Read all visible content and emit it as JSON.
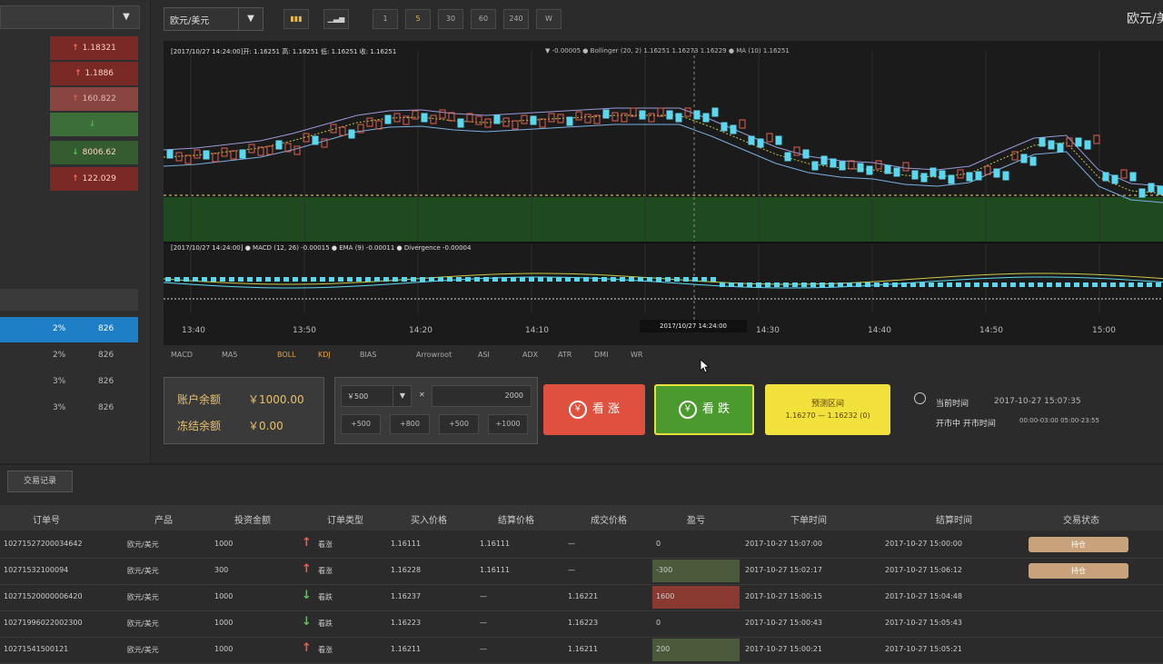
{
  "left_panel": {
    "select_value": "",
    "price_chips": [
      {
        "dir": "up",
        "value": "1.18321",
        "color": "#7a2a26"
      },
      {
        "dir": "up",
        "value": "1.1886",
        "color": "#7a2a26"
      },
      {
        "dir": "up",
        "value": "160.822",
        "color": "#9a4a44",
        "light": true
      },
      {
        "dir": "down",
        "value": "",
        "color": "#3e7a3a",
        "light": true
      },
      {
        "dir": "down",
        "value": "8006.62",
        "color": "#355c31"
      },
      {
        "dir": "up",
        "value": "122.029",
        "color": "#7a2a26"
      }
    ],
    "sub_headers": [
      "",
      "",
      ""
    ],
    "sub_rows": [
      {
        "c1": "2%",
        "c2": "826",
        "selected": true
      },
      {
        "c1": "2%",
        "c2": "826",
        "selected": false
      },
      {
        "c1": "3%",
        "c2": "826",
        "selected": false
      },
      {
        "c1": "3%",
        "c2": "826",
        "selected": false
      }
    ]
  },
  "toolbar": {
    "symbol_select": "欧元/美元",
    "chart_type_icons": [
      "candles-icon",
      "bars-icon"
    ],
    "timeframes": [
      "1",
      "5",
      "30",
      "60",
      "240",
      "W"
    ],
    "active_timeframe": "5",
    "pair_title": "欧元/美元"
  },
  "chart": {
    "main_caption": "[2017/10/27 14:24:00]开: 1.16251  高: 1.16251  低: 1.16251  收: 1.16251",
    "main_indicators": "▼ -0.00005   ● Bollinger (20, 2)   1.16251   1.16273   1.16229   ● MA (10)   1.16251",
    "sub_caption": "[2017/10/27 14:24:00]  ● MACD (12, 26)  -0.00015   ● EMA (9)  -0.00011   ● Divergence  -0.00004",
    "time_labels": [
      "13:40",
      "13:50",
      "14:20",
      "14:10",
      "14:30",
      "14:40",
      "14:50",
      "15:00"
    ],
    "cursor_time": "2017/10/27 14:24:00",
    "indicator_tabs": [
      "MACD",
      "MA5",
      "BOLL",
      "KDJ",
      "BIAS",
      "Arrowroot",
      "ASI",
      "ADX",
      "ATR",
      "DMI",
      "WR"
    ],
    "active_indicator_tabs": [
      "BOLL",
      "KDJ"
    ]
  },
  "account": {
    "balance_label": "账户余额",
    "balance_value": "￥1000.00",
    "frozen_label": "冻结余额",
    "frozen_value": "￥0.00"
  },
  "order_entry": {
    "amount_select": "￥500",
    "amount_input": "2000",
    "quick_amounts": [
      "+500",
      "+800",
      "+500",
      "+1000"
    ]
  },
  "actions": {
    "buy_up_label": "看 涨",
    "buy_down_label": "看 跌",
    "yellow_top": "预测区间",
    "yellow_bottom": "1.16270 — 1.16232 (0)",
    "buy_up_color": "#e0503e",
    "buy_down_color": "#4a9a2e",
    "yellow_color": "#f2e13a"
  },
  "session": {
    "line1_label": "当前时间",
    "line1_value": "2017-10-27 15:07:35",
    "line2_label": "开市中  开市时间",
    "line2_value": "00:00-03:00 05:00-23:55"
  },
  "orders": {
    "tab_label": "交易记录",
    "headers": [
      "订单号",
      "产品",
      "投资金额",
      "订单类型",
      "买入价格",
      "结算价格",
      "成交价格",
      "盈亏",
      "下单时间",
      "结算时间",
      "交易状态"
    ],
    "rows": [
      {
        "id": "10271527200034642",
        "product": "欧元/美元",
        "amount": "1000",
        "dir": "up",
        "type": "看涨",
        "open": "1.16111",
        "close": "1.16111",
        "deal": "—",
        "pnl": "0",
        "pnl_bg": "",
        "order_time": "2017-10-27 15:07:00",
        "settle_time": "2017-10-27 15:00:00",
        "status": "持仓"
      },
      {
        "id": "10271532100094",
        "product": "欧元/美元",
        "amount": "300",
        "dir": "up",
        "type": "看涨",
        "open": "1.16228",
        "close": "1.16111",
        "deal": "—",
        "pnl": "-300",
        "pnl_bg": "#4a5a3a",
        "order_time": "2017-10-27 15:02:17",
        "settle_time": "2017-10-27 15:06:12",
        "status": "持仓"
      },
      {
        "id": "10271520000006420",
        "product": "欧元/美元",
        "amount": "1000",
        "dir": "down",
        "type": "看跌",
        "open": "1.16237",
        "close": "—",
        "deal": "1.16221",
        "pnl": "1600",
        "pnl_bg": "#8a3a30",
        "order_time": "2017-10-27 15:00:15",
        "settle_time": "2017-10-27 15:04:48",
        "status": ""
      },
      {
        "id": "10271996022002300",
        "product": "欧元/美元",
        "amount": "1000",
        "dir": "down",
        "type": "看跌",
        "open": "1.16223",
        "close": "—",
        "deal": "1.16223",
        "pnl": "0",
        "pnl_bg": "",
        "order_time": "2017-10-27 15:00:43",
        "settle_time": "2017-10-27 15:05:43",
        "status": ""
      },
      {
        "id": "10271541500121",
        "product": "欧元/美元",
        "amount": "1000",
        "dir": "up",
        "type": "看涨",
        "open": "1.16211",
        "close": "—",
        "deal": "1.16211",
        "pnl": "200",
        "pnl_bg": "#4a5a3a",
        "order_time": "2017-10-27 15:00:21",
        "settle_time": "2017-10-27 15:05:21",
        "status": ""
      }
    ]
  }
}
